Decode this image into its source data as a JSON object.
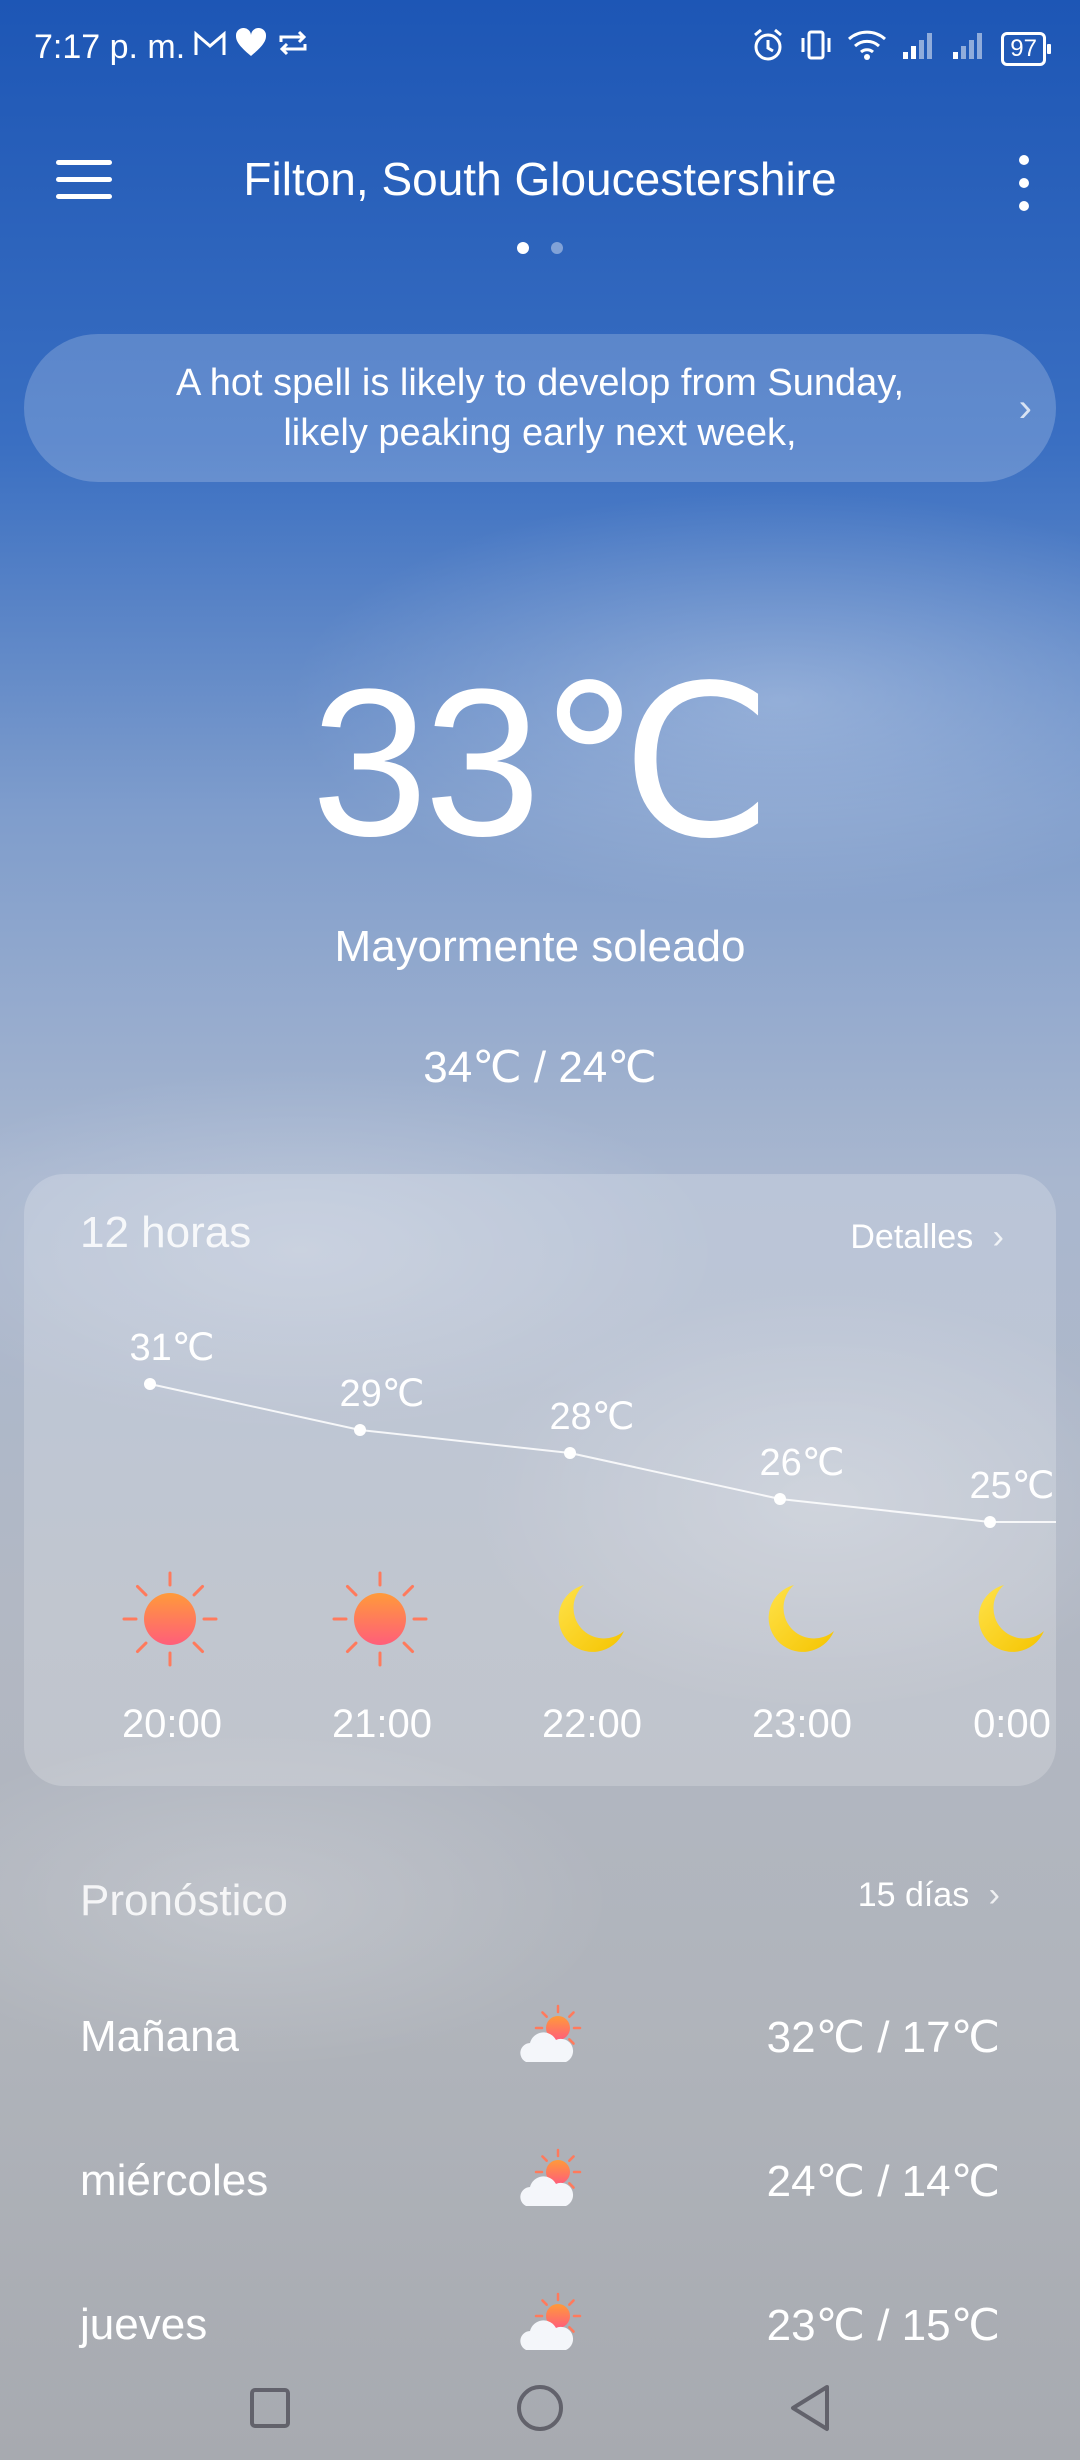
{
  "status_bar": {
    "time": "7:17 p. m.",
    "battery": "97",
    "left_icons": [
      "gmail-icon",
      "heart-icon",
      "repeat-icon"
    ],
    "right_icons": [
      "alarm-icon",
      "vibrate-icon",
      "wifi-icon",
      "signal-icon",
      "signal-icon",
      "battery-icon"
    ]
  },
  "header": {
    "location": "Filton, South Gloucestershire",
    "page_count": 2,
    "active_page": 1
  },
  "alert": {
    "text": "A hot spell is likely to develop from Sunday, likely peaking early next week,"
  },
  "current": {
    "temperature": "33℃",
    "condition": "Mayormente soleado",
    "high_low": "34℃ / 24℃"
  },
  "hourly": {
    "title": "12 horas",
    "details_label": "Detalles",
    "items": [
      {
        "time": "20:00",
        "temp_label": "31℃",
        "temp": 31,
        "icon": "sun-icon"
      },
      {
        "time": "21:00",
        "temp_label": "29℃",
        "temp": 29,
        "icon": "sun-icon"
      },
      {
        "time": "22:00",
        "temp_label": "28℃",
        "temp": 28,
        "icon": "moon-icon"
      },
      {
        "time": "23:00",
        "temp_label": "26℃",
        "temp": 26,
        "icon": "moon-icon"
      },
      {
        "time": "0:00",
        "temp_label": "25℃",
        "temp": 25,
        "icon": "moon-icon"
      }
    ]
  },
  "forecast": {
    "title": "Pronóstico",
    "link_label": "15 días",
    "days": [
      {
        "day": "Mañana",
        "icon": "partly-cloudy-icon",
        "range": "32℃ / 17℃"
      },
      {
        "day": "miércoles",
        "icon": "partly-cloudy-icon",
        "range": "24℃ / 14℃"
      },
      {
        "day": "jueves",
        "icon": "partly-cloudy-icon",
        "range": "23℃ / 15℃"
      }
    ]
  },
  "nav": {
    "buttons": [
      "recents-square-icon",
      "home-circle-icon",
      "back-triangle-icon"
    ]
  }
}
